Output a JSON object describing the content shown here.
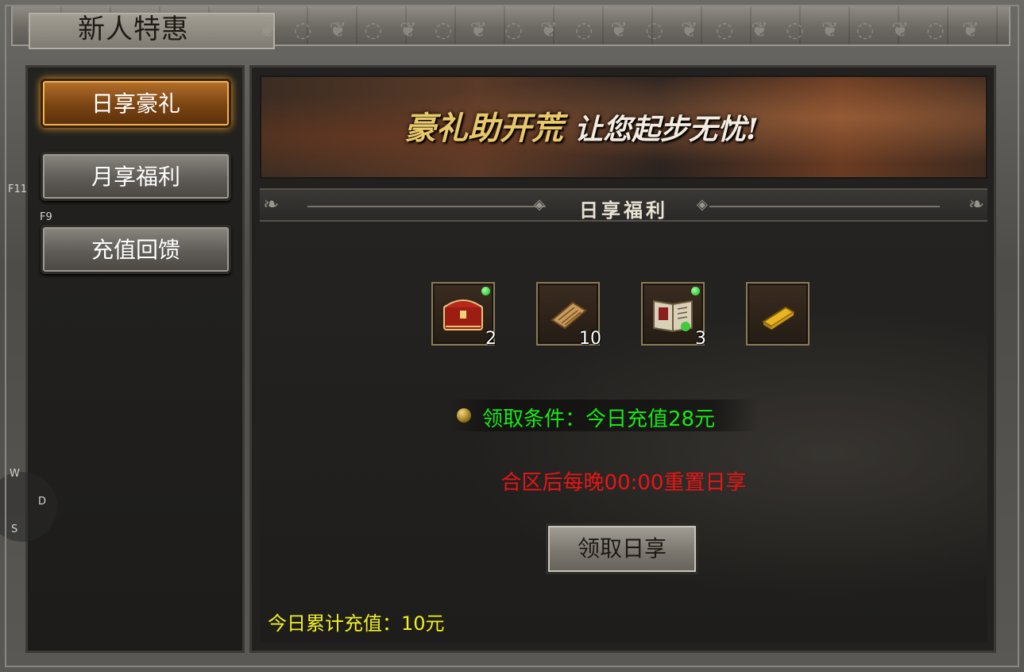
{
  "window": {
    "title": "新人特惠"
  },
  "sidebar": {
    "items": [
      {
        "label": "日享豪礼",
        "active": true
      },
      {
        "label": "月享福利",
        "active": false
      },
      {
        "label": "充值回馈",
        "active": false
      }
    ]
  },
  "overlay_keys": {
    "f11": "F11",
    "f9": "F9",
    "w": "W",
    "d": "D",
    "s": "S"
  },
  "banner": {
    "text_main": "豪礼助开荒",
    "text_sub": "让您起步无忧!"
  },
  "section": {
    "title": "日享福利"
  },
  "rewards": [
    {
      "icon": "treasure-chest-icon",
      "count": "2",
      "green_dot": true
    },
    {
      "icon": "scroll-icon",
      "count": "10",
      "green_dot": false
    },
    {
      "icon": "skill-book-icon",
      "count": "3",
      "green_dot": true
    },
    {
      "icon": "gold-bar-icon",
      "count": "",
      "green_dot": false
    }
  ],
  "condition": {
    "text": "领取条件：今日充值28元"
  },
  "reset_notice": "合区后每晚00:00重置日享",
  "claim_button": {
    "label": "领取日享"
  },
  "daily_total": {
    "text": "今日累计充值：10元"
  },
  "colors": {
    "condition": "#18e818",
    "reset_notice": "#e81515",
    "total": "#f0f020",
    "active_tab": "#b46f2c"
  }
}
